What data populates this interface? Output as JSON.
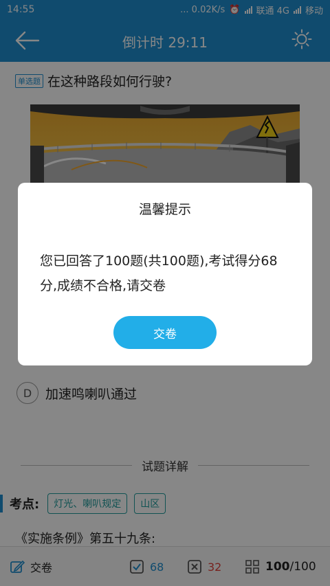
{
  "status_bar": {
    "time": "14:55",
    "speed": "... 0.02K/s",
    "carrier1": "联通 4G",
    "carrier2": "移动"
  },
  "header": {
    "countdown": "倒计时 29:11"
  },
  "question": {
    "type_tag": "单选题",
    "text": "在这种路段如何行驶?"
  },
  "options": {
    "d_letter": "D",
    "d_text": "加速鸣喇叭通过"
  },
  "analysis": {
    "heading": "试题详解",
    "knowledge_label": "考点:",
    "tags": [
      "灯光、喇叭规定",
      "山区"
    ],
    "law_text": "《实施条例》第五十九条:"
  },
  "bottom_bar": {
    "submit_label": "交卷",
    "correct_count": "68",
    "wrong_count": "32",
    "progress_current": "100",
    "progress_sep": "/",
    "progress_total": "100"
  },
  "dialog": {
    "title": "温馨提示",
    "message": "您已回答了100题(共100题),考试得分68分,成绩不合格,请交卷",
    "button": "交卷"
  },
  "colors": {
    "header_blue": "#1f8fd0",
    "button_blue": "#22aee8",
    "correct_blue": "#1f8fd0",
    "wrong_red": "#e0403a",
    "tag_teal": "#1f9c9c"
  },
  "icons": [
    "back-arrow-icon",
    "brightness-icon",
    "edit-icon",
    "check-box-icon",
    "cross-box-icon",
    "grid-icon"
  ]
}
